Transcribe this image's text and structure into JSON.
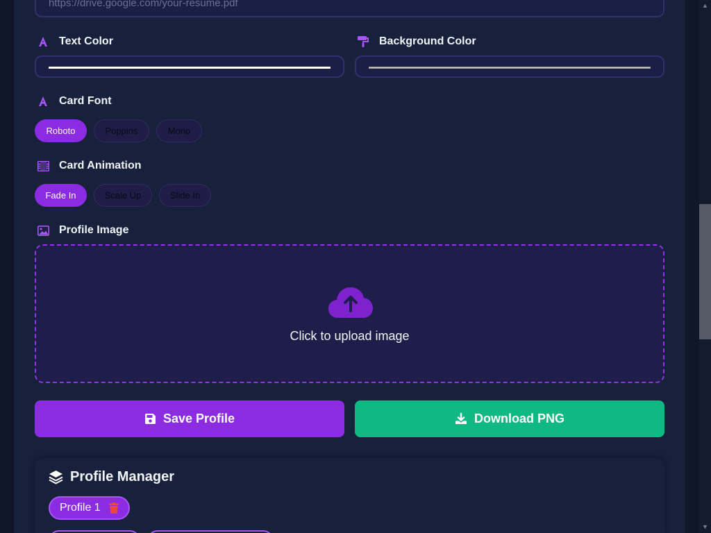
{
  "resume": {
    "placeholder": "https://drive.google.com/your-resume.pdf"
  },
  "text_color": {
    "label": "Text Color",
    "value": "#ffffff"
  },
  "background_color": {
    "label": "Background Color",
    "value": "#cccccc"
  },
  "card_font": {
    "label": "Card Font",
    "options": [
      "Roboto",
      "Poppins",
      "Mono"
    ],
    "selected": "Roboto"
  },
  "card_animation": {
    "label": "Card Animation",
    "options": [
      "Fade In",
      "Scale Up",
      "Slide In"
    ],
    "selected": "Fade In"
  },
  "profile_image": {
    "label": "Profile Image",
    "upload_text": "Click to upload image"
  },
  "actions": {
    "save_label": "Save Profile",
    "download_label": "Download PNG"
  },
  "profile_manager": {
    "title": "Profile Manager",
    "profiles": [
      "Profile 1"
    ]
  },
  "colors": {
    "accent": "#8b2be2",
    "success": "#10b981",
    "danger": "#ef4444"
  }
}
